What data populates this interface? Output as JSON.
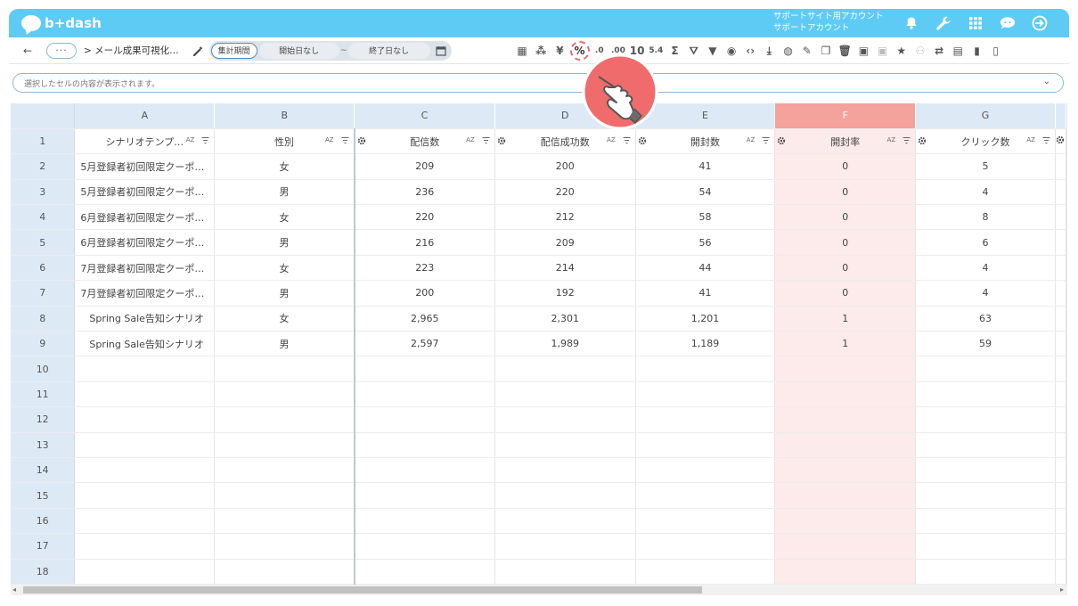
{
  "app": {
    "logo_text": "b+dash",
    "account_line1": "サポートサイト用アカウント",
    "account_line2": "サポートアカウント",
    "top_icons": [
      "bell-icon",
      "wrench-icon",
      "apps-grid-icon",
      "chat-icon",
      "logout-icon"
    ]
  },
  "toolbar": {
    "back_label": "←",
    "more_label": "···",
    "breadcrumb": "> メール成果可視化…",
    "period_active": "集計期間",
    "start_date": "開始日なし",
    "separator": "~",
    "end_date": "終了日なし",
    "tools": [
      {
        "name": "layout-icon",
        "glyph": "▦"
      },
      {
        "name": "loading-icon",
        "glyph": "⁂"
      },
      {
        "name": "yen-icon",
        "glyph": "¥"
      },
      {
        "name": "percent-icon",
        "glyph": "%"
      },
      {
        "name": "decimal-decrease-icon",
        "glyph": ".0"
      },
      {
        "name": "decimal-increase-icon",
        "glyph": ".00"
      },
      {
        "name": "round-icon",
        "glyph": "10"
      },
      {
        "name": "thousands-icon",
        "glyph": "5.4"
      },
      {
        "name": "sum-icon",
        "glyph": "Σ"
      },
      {
        "name": "filter-clear-icon",
        "glyph": "⛛"
      },
      {
        "name": "filter-icon",
        "glyph": "▼"
      },
      {
        "name": "eye-icon",
        "glyph": "◉"
      },
      {
        "name": "code-icon",
        "glyph": "‹›"
      },
      {
        "name": "download-icon",
        "glyph": "⤓"
      },
      {
        "name": "chart-icon",
        "glyph": "◍"
      },
      {
        "name": "edit-icon",
        "glyph": "✎"
      },
      {
        "name": "copy-icon",
        "glyph": "❐"
      },
      {
        "name": "delete-icon",
        "glyph": "🗑"
      },
      {
        "name": "archive-icon",
        "glyph": "▣"
      },
      {
        "name": "archive-disabled-icon",
        "glyph": "▣"
      },
      {
        "name": "star-icon",
        "glyph": "★"
      },
      {
        "name": "user-check-icon",
        "glyph": "⚇"
      },
      {
        "name": "swap-icon",
        "glyph": "⇄"
      },
      {
        "name": "calendar-icon",
        "glyph": "▤"
      },
      {
        "name": "file-icon",
        "glyph": "▮"
      },
      {
        "name": "clipboard-icon",
        "glyph": "▯"
      }
    ]
  },
  "formula_bar": {
    "placeholder": "選択したセルの内容が表示されます。"
  },
  "grid": {
    "columns": [
      "A",
      "B",
      "C",
      "D",
      "E",
      "F",
      "G"
    ],
    "selected_column": "F",
    "header_row": [
      "シナリオテンプ…",
      "性別",
      "配信数",
      "配信成功数",
      "開封数",
      "開封率",
      "クリック数"
    ],
    "sort_label": "AZ",
    "rows": [
      {
        "n": "2",
        "cells": [
          "5月登録者初回限定クーポ…",
          "女",
          "209",
          "200",
          "41",
          "0",
          "5"
        ]
      },
      {
        "n": "3",
        "cells": [
          "5月登録者初回限定クーポ…",
          "男",
          "236",
          "220",
          "54",
          "0",
          "4"
        ]
      },
      {
        "n": "4",
        "cells": [
          "6月登録者初回限定クーポ…",
          "女",
          "220",
          "212",
          "58",
          "0",
          "8"
        ]
      },
      {
        "n": "5",
        "cells": [
          "6月登録者初回限定クーポ…",
          "男",
          "216",
          "209",
          "56",
          "0",
          "6"
        ]
      },
      {
        "n": "6",
        "cells": [
          "7月登録者初回限定クーポ…",
          "女",
          "223",
          "214",
          "44",
          "0",
          "4"
        ]
      },
      {
        "n": "7",
        "cells": [
          "7月登録者初回限定クーポ…",
          "男",
          "200",
          "192",
          "41",
          "0",
          "4"
        ]
      },
      {
        "n": "8",
        "cells": [
          "Spring Sale告知シナリオ",
          "女",
          "2,965",
          "2,301",
          "1,201",
          "1",
          "63"
        ]
      },
      {
        "n": "9",
        "cells": [
          "Spring Sale告知シナリオ",
          "男",
          "2,597",
          "1,989",
          "1,189",
          "1",
          "59"
        ]
      },
      {
        "n": "10",
        "cells": [
          "",
          "",
          "",
          "",
          "",
          "",
          ""
        ]
      },
      {
        "n": "11",
        "cells": [
          "",
          "",
          "",
          "",
          "",
          "",
          ""
        ]
      },
      {
        "n": "12",
        "cells": [
          "",
          "",
          "",
          "",
          "",
          "",
          ""
        ]
      },
      {
        "n": "13",
        "cells": [
          "",
          "",
          "",
          "",
          "",
          "",
          ""
        ]
      },
      {
        "n": "14",
        "cells": [
          "",
          "",
          "",
          "",
          "",
          "",
          ""
        ]
      },
      {
        "n": "15",
        "cells": [
          "",
          "",
          "",
          "",
          "",
          "",
          ""
        ]
      },
      {
        "n": "16",
        "cells": [
          "",
          "",
          "",
          "",
          "",
          "",
          ""
        ]
      },
      {
        "n": "17",
        "cells": [
          "",
          "",
          "",
          "",
          "",
          "",
          ""
        ]
      },
      {
        "n": "18",
        "cells": [
          "",
          "",
          "",
          "",
          "",
          "",
          ""
        ]
      }
    ]
  },
  "colors": {
    "topbar": "#5ecbf5",
    "selected_header": "#f4a29b",
    "selected_cells": "#fdeaea",
    "row_header": "#ddeaf6",
    "pointer": "#f06b6b"
  }
}
